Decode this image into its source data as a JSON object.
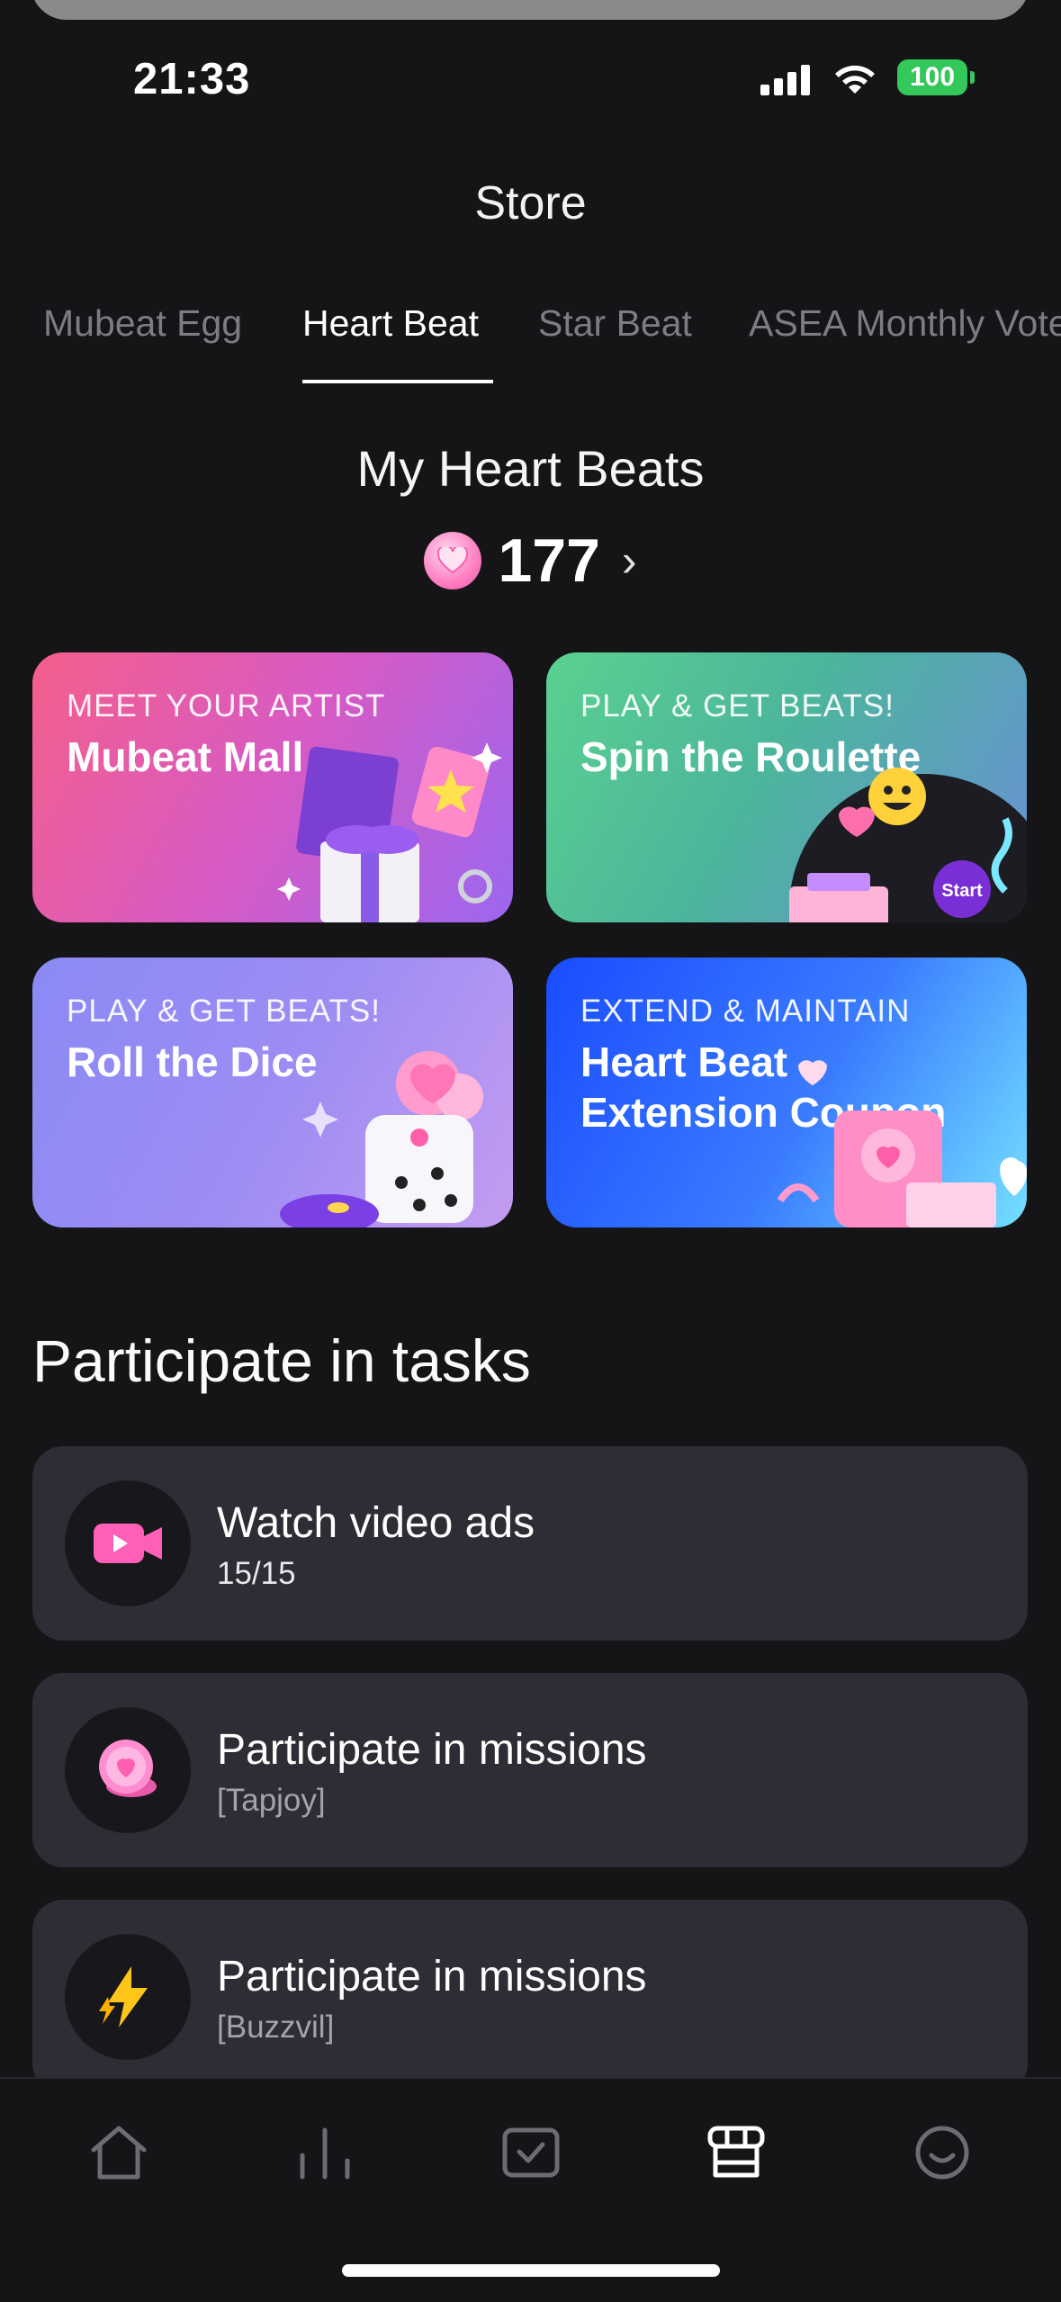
{
  "status_bar": {
    "time": "21:33",
    "battery": "100"
  },
  "header": {
    "title": "Store"
  },
  "tabs": [
    {
      "label": "Mubeat Egg",
      "active": false
    },
    {
      "label": "Heart Beat",
      "active": true
    },
    {
      "label": "Star Beat",
      "active": false
    },
    {
      "label": "ASEA Monthly Vote",
      "active": false
    }
  ],
  "balance": {
    "title": "My Heart Beats",
    "value": "177"
  },
  "cards": [
    {
      "kicker": "MEET YOUR ARTIST",
      "title": "Mubeat Mall"
    },
    {
      "kicker": "PLAY & GET BEATS!",
      "title": "Spin the Roulette",
      "roulette_start": "Start"
    },
    {
      "kicker": "PLAY & GET BEATS!",
      "title": "Roll the Dice"
    },
    {
      "kicker": "EXTEND & MAINTAIN",
      "title": "Heart Beat Extension Coupon"
    }
  ],
  "tasks_section": {
    "title": "Participate in tasks"
  },
  "tasks": [
    {
      "title": "Watch video ads",
      "subtitle": "15/15",
      "icon": "video-camera-icon"
    },
    {
      "title": "Participate in missions",
      "subtitle": "[Tapjoy]",
      "icon": "heart-coin-icon"
    },
    {
      "title": "Participate in missions",
      "subtitle": "[Buzzvil]",
      "icon": "lightning-icon"
    }
  ],
  "bottom_nav": [
    {
      "name": "home",
      "icon": "home-icon",
      "active": false
    },
    {
      "name": "chart",
      "icon": "chart-icon",
      "active": false
    },
    {
      "name": "vote",
      "icon": "checkbox-icon",
      "active": false
    },
    {
      "name": "store",
      "icon": "store-icon",
      "active": true
    },
    {
      "name": "profile",
      "icon": "smile-icon",
      "active": false
    }
  ],
  "colors": {
    "background": "#151517",
    "task_card": "#2c2d35",
    "accent_pink": "#ff6fbd",
    "battery_green": "#34c759"
  }
}
